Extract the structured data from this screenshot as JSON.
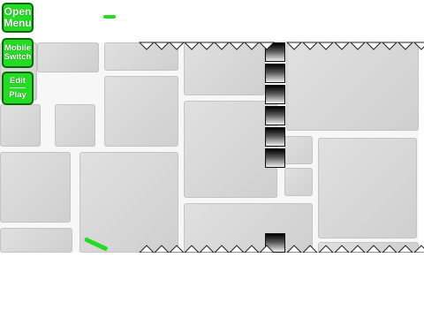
{
  "buttons": {
    "open_menu": [
      "Open",
      "Menu"
    ],
    "mobile_switch": [
      "Mobile",
      "Switch"
    ],
    "edit_play": [
      "Edit",
      "Play"
    ]
  },
  "colors": {
    "button_fill": "#22dd22",
    "button_border": "#0a6a0a",
    "player": "#22dd22"
  },
  "icons": {
    "top_spikes": "spike-row-down-icon",
    "bottom_spikes": "spike-row-up-icon",
    "player": "player-bar-icon"
  }
}
